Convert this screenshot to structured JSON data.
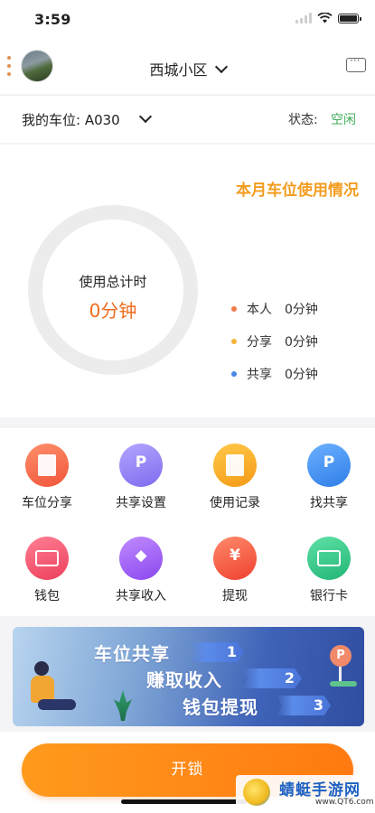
{
  "status_bar": {
    "time": "3:59"
  },
  "header": {
    "community": "西城小区"
  },
  "slot": {
    "label": "我的车位: A030",
    "state_label": "状态:",
    "state_value": "空闲"
  },
  "usage": {
    "title": "本月车位使用情况",
    "ring_label": "使用总计时",
    "ring_value": "0分钟",
    "legend": [
      {
        "name": "本人",
        "value": "0分钟",
        "color": "#f07a4a"
      },
      {
        "name": "分享",
        "value": "0分钟",
        "color": "#f5b33a"
      },
      {
        "name": "共享",
        "value": "0分钟",
        "color": "#4a86e8"
      }
    ]
  },
  "menu": [
    {
      "label": "车位分享",
      "icon": "share-slot-icon",
      "color": "#f26d4f"
    },
    {
      "label": "共享设置",
      "icon": "share-settings-icon",
      "color": "#8d7cf0"
    },
    {
      "label": "使用记录",
      "icon": "usage-record-icon",
      "color": "#f6a623"
    },
    {
      "label": "找共享",
      "icon": "find-share-icon",
      "color": "#3d8bef"
    },
    {
      "label": "钱包",
      "icon": "wallet-icon",
      "color": "#f0536d"
    },
    {
      "label": "共享收入",
      "icon": "share-income-icon",
      "color": "#9a5cf0"
    },
    {
      "label": "提现",
      "icon": "withdraw-icon",
      "color": "#f2553e"
    },
    {
      "label": "银行卡",
      "icon": "bank-card-icon",
      "color": "#35c88a"
    }
  ],
  "banner": {
    "line1": "车位共享",
    "num1": "1",
    "line2": "赚取收入",
    "num2": "2",
    "line3": "钱包提现",
    "num3": "3",
    "sign": "P"
  },
  "bottom": {
    "unlock_label": "开锁"
  },
  "watermark": {
    "name": "蜻蜓手游网",
    "url": "www.QT6.com"
  }
}
